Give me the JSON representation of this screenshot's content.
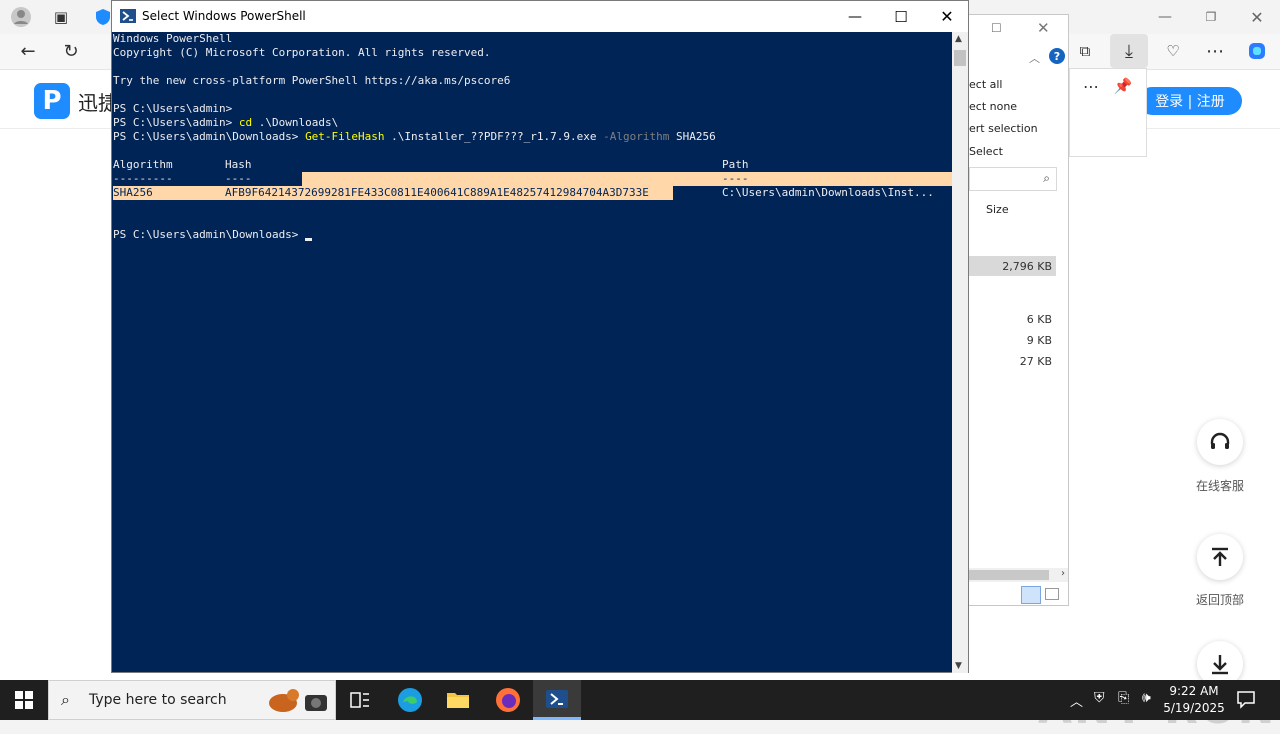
{
  "browser": {
    "site_name": "迅捷",
    "logo_letter": "P",
    "login_label": "登录 | 注册",
    "online_service_label": "在线客服",
    "back_to_top_label": "返回顶部",
    "watermark": "ANY RUN"
  },
  "explorer": {
    "menu_items": [
      "ect all",
      "ect none",
      "ert selection",
      "Select"
    ],
    "column_size": "Size",
    "sizes": [
      "2,796 KB",
      "6 KB",
      "9 KB",
      "27 KB"
    ]
  },
  "powershell": {
    "title": "Select Windows PowerShell",
    "lines": {
      "l1": "Windows PowerShell",
      "l2": "Copyright (C) Microsoft Corporation. All rights reserved.",
      "l3": "Try the new cross-platform PowerShell https://aka.ms/pscore6",
      "l4": "PS C:\\Users\\admin> ",
      "l5_prompt": "PS C:\\Users\\admin> ",
      "l5_cmd": "cd",
      "l5_arg": " .\\Downloads\\",
      "l6_prompt": "PS C:\\Users\\admin\\Downloads> ",
      "l6_cmd": "Get-FileHash",
      "l6_arg": " .\\Installer_??PDF???_r1.7.9.exe ",
      "l6_param": "-Algorithm",
      "l6_val": " SHA256",
      "header_algorithm": "Algorithm",
      "header_hash": "Hash",
      "header_path": "Path",
      "dash_algorithm": "---------",
      "dash_hash": "----",
      "dash_path": "----",
      "row_algorithm": "SHA256",
      "row_hash": "AFB9F64214372699281FE433C0811E400641C889A1E48257412984704A3D733E",
      "row_path": "C:\\Users\\admin\\Downloads\\Inst...",
      "final_prompt": "PS C:\\Users\\admin\\Downloads> "
    }
  },
  "taskbar": {
    "search_placeholder": "Type here to search",
    "time": "9:22 AM",
    "date": "5/19/2025"
  },
  "colors": {
    "console_bg": "#012456",
    "console_fg": "#eeedf0",
    "selection": "#ffd7a8",
    "command_yellow": "#ffff00",
    "accent_blue": "#1e8bff"
  }
}
